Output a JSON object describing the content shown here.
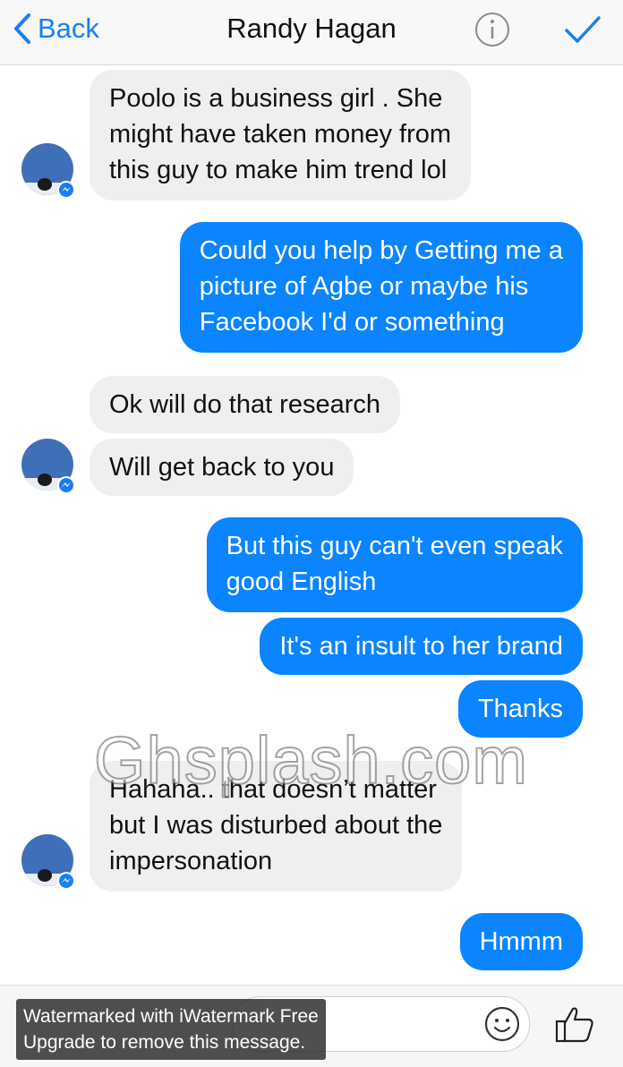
{
  "header": {
    "back_label": "Back",
    "title": "Randy Hagan"
  },
  "messages": [
    {
      "side": "in",
      "lines": [
        "Poolo is a business girl . She",
        "might have taken money from",
        "this guy to make him trend lol"
      ]
    },
    {
      "side": "out",
      "lines": [
        "Could you help by Getting me a",
        "picture of Agbe or maybe his",
        "Facebook I'd or something"
      ]
    },
    {
      "side": "in",
      "lines": [
        "Ok will do that research"
      ]
    },
    {
      "side": "in",
      "lines": [
        "Will get back to you"
      ]
    },
    {
      "side": "out",
      "lines": [
        "But this guy can't even speak",
        "good English"
      ]
    },
    {
      "side": "out",
      "lines": [
        "It's an insult to her brand"
      ]
    },
    {
      "side": "out",
      "lines": [
        "Thanks"
      ]
    },
    {
      "side": "in",
      "lines": [
        "Hahaha.. that doesn’t matter",
        "but I was disturbed about the",
        "impersonation"
      ]
    },
    {
      "side": "out",
      "lines": [
        "Hmmm"
      ]
    }
  ],
  "watermark": "Ghsplash.com",
  "composer": {
    "emoji_icon": "smile-icon",
    "like_icon": "thumbs-up-icon"
  },
  "banner": {
    "line1": "Watermarked with iWatermark Free",
    "line2": "Upgrade to remove this message."
  },
  "colors": {
    "accent": "#0a84ff",
    "incoming_bubble": "#efefef",
    "link": "#1a7ef0"
  }
}
